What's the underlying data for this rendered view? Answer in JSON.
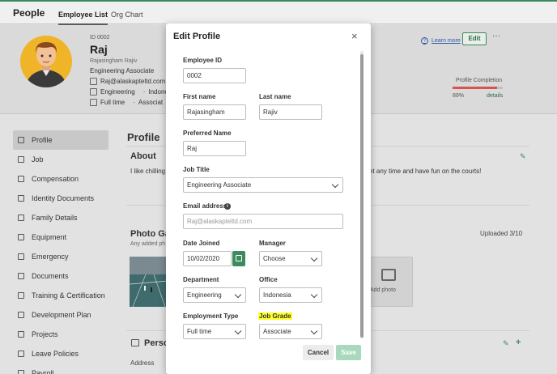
{
  "topbar": {
    "brand": "People",
    "tabs": [
      {
        "label": "Employee List",
        "active": true
      },
      {
        "label": "Org Chart",
        "active": false
      }
    ]
  },
  "profile_header": {
    "employee_id": "ID 0002",
    "name": "Raj",
    "legal_name": "Rajasingham Rajiv",
    "job_title": "Engineering Associate",
    "email": "Raj@alaskapteltd.com",
    "department": "Engineering",
    "office_truncated": "Indone",
    "employment_type": "Full time",
    "grade_truncated": "Associat",
    "learn_more": "Learn more",
    "edit_label": "Edit",
    "more_label": "···",
    "completion_label": "Profile Completion",
    "completion_pct": "89%",
    "completion_value": 0.89,
    "completion_details": "details"
  },
  "sidenav": {
    "items": [
      {
        "label": "Profile",
        "icon": "person-icon",
        "active": true
      },
      {
        "label": "Job",
        "icon": "briefcase-icon",
        "active": false
      },
      {
        "label": "Compensation",
        "icon": "money-icon",
        "active": false
      },
      {
        "label": "Identity Documents",
        "icon": "id-card-icon",
        "active": false
      },
      {
        "label": "Family Details",
        "icon": "family-icon",
        "active": false
      },
      {
        "label": "Equipment",
        "icon": "laptop-icon",
        "active": false
      },
      {
        "label": "Emergency",
        "icon": "phone-icon",
        "active": false
      },
      {
        "label": "Documents",
        "icon": "document-icon",
        "active": false
      },
      {
        "label": "Training & Certification",
        "icon": "certificate-icon",
        "active": false
      },
      {
        "label": "Development Plan",
        "icon": "chart-icon",
        "active": false
      },
      {
        "label": "Projects",
        "icon": "project-icon",
        "active": false
      },
      {
        "label": "Leave Policies",
        "icon": "leave-icon",
        "active": false
      },
      {
        "label": "Payroll",
        "icon": "payroll-icon",
        "active": false
      }
    ]
  },
  "main": {
    "section_title": "Profile",
    "about_title": "About",
    "about_text_start": "I like chilling",
    "about_text_end": "et any time and have fun on the courts!",
    "gallery_title": "Photo Ga",
    "gallery_sub": "Any added ph",
    "uploaded": "Uploaded 3/10",
    "add_photo": "Add photo",
    "personal_title": "Perso",
    "address_label": "Address"
  },
  "modal": {
    "title": "Edit Profile",
    "close": "×",
    "fields": {
      "employee_id": {
        "label": "Employee ID",
        "value": "0002"
      },
      "first_name": {
        "label": "First name",
        "value": "Rajasingham"
      },
      "last_name": {
        "label": "Last name",
        "value": "Rajiv"
      },
      "preferred_name": {
        "label": "Preferred Name",
        "value": "Raj"
      },
      "job_title": {
        "label": "Job Title",
        "value": "Engineering Associate"
      },
      "email": {
        "label": "Email address",
        "placeholder": "Raj@alaskapteltd.com"
      },
      "date_joined": {
        "label": "Date Joined",
        "value": "10/02/2020"
      },
      "manager": {
        "label": "Manager",
        "value": "Choose"
      },
      "department": {
        "label": "Department",
        "value": "Engineering"
      },
      "office": {
        "label": "Office",
        "value": "Indonesia"
      },
      "employment_type": {
        "label": "Employment Type",
        "value": "Full time"
      },
      "job_grade": {
        "label": "Job Grade",
        "value": "Associate"
      }
    },
    "cancel": "Cancel",
    "save": "Save"
  },
  "colors": {
    "accent": "#3c8a5e",
    "highlight": "#ffff29",
    "completion_bar": "#d9534f"
  }
}
